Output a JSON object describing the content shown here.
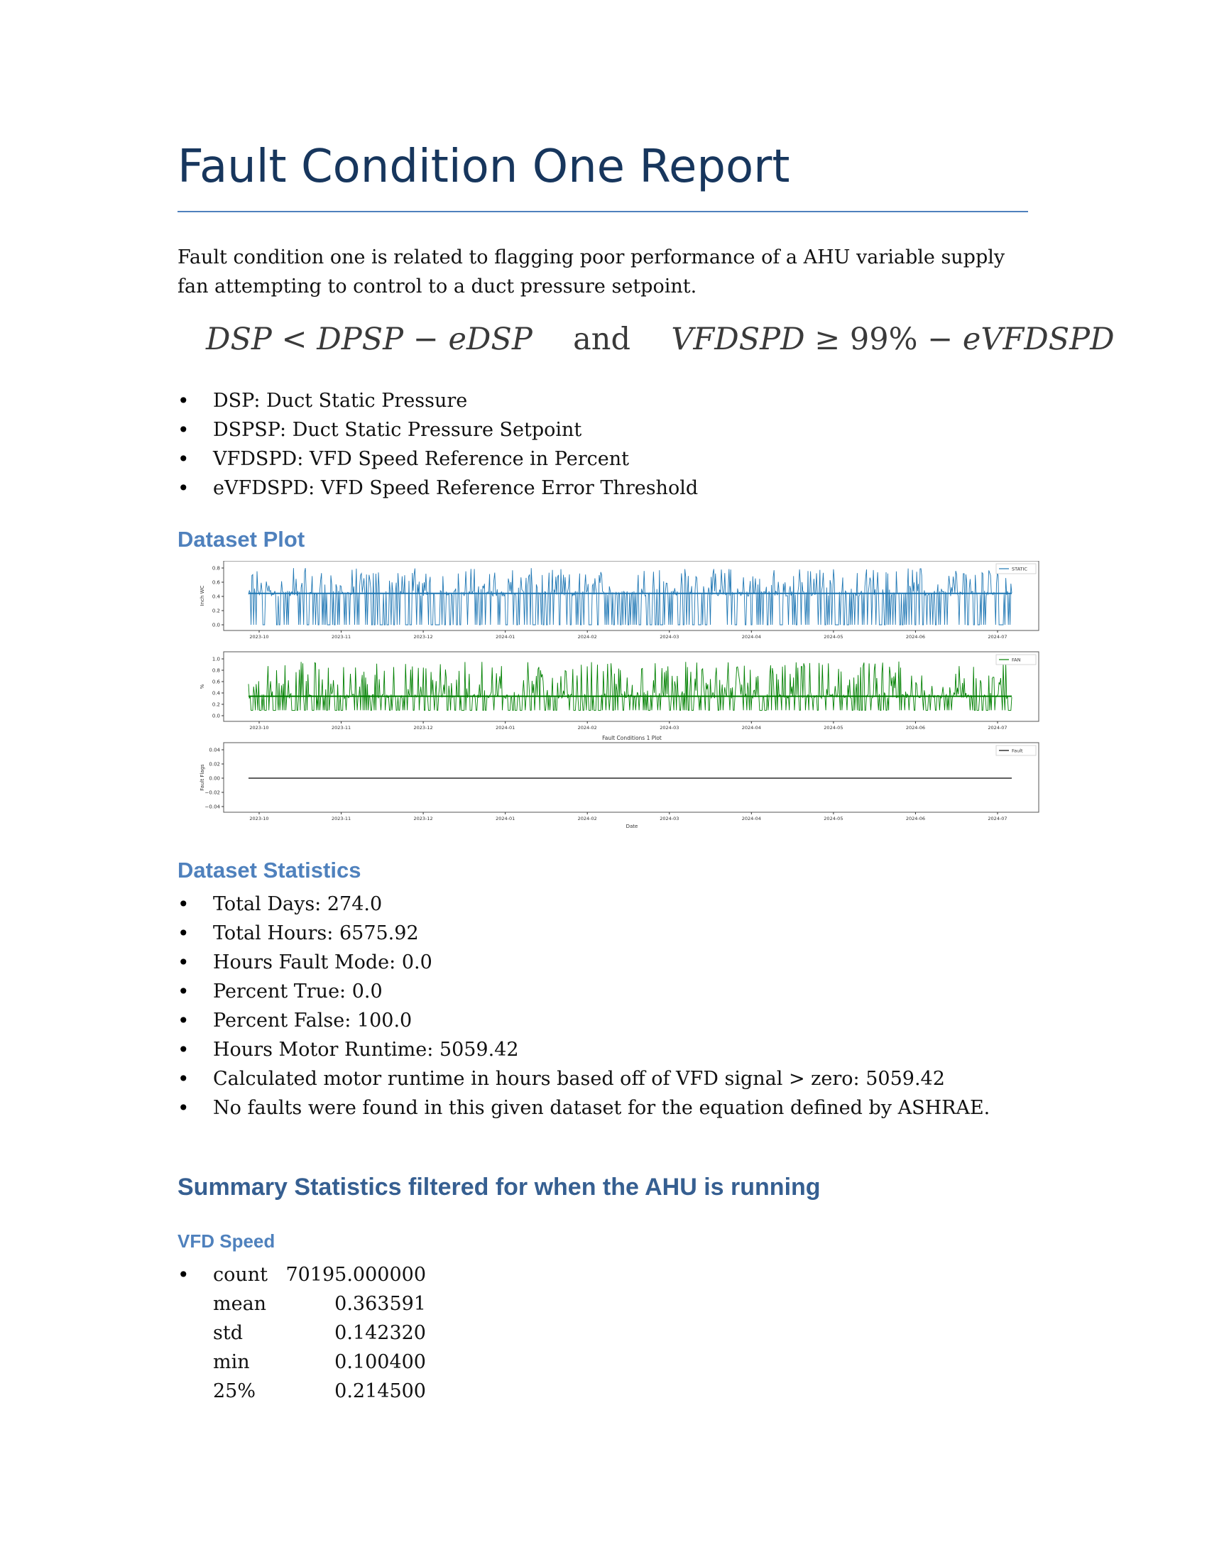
{
  "title": "Fault Condition One Report",
  "intro": "Fault condition one is related to flagging poor performance of a AHU variable supply fan attempting to control to a duct pressure setpoint.",
  "equation": {
    "lhs_a": "DSP",
    "lt": "<",
    "lhs_b": "DPSP",
    "minus1": "−",
    "lhs_c": "eDSP",
    "and": "and",
    "rhs_a": "VFDSPD",
    "ge": "≥",
    "rhs_b": "99%",
    "minus2": "−",
    "rhs_c": "eVFDSPD"
  },
  "definitions": [
    "DSP: Duct Static Pressure",
    "DSPSP: Duct Static Pressure Setpoint",
    "VFDSPD: VFD Speed Reference in Percent",
    "eVFDSPD: VFD Speed Reference Error Threshold"
  ],
  "dataset_plot_heading": "Dataset Plot",
  "chart_data": [
    {
      "type": "line",
      "x_ticks": [
        "2023-10",
        "2023-11",
        "2023-12",
        "2024-01",
        "2024-02",
        "2024-03",
        "2024-04",
        "2024-05",
        "2024-06",
        "2024-07"
      ],
      "ylabel": "Inch WC",
      "y_ticks": [
        "0.8",
        "0.6",
        "0.4",
        "0.2",
        "0.0"
      ],
      "ylim": [
        0.0,
        0.85
      ],
      "series": [
        {
          "name": "STATIC",
          "color": "#1f77b4",
          "baseline": 0.47,
          "low": 0.0,
          "high": 0.85
        }
      ]
    },
    {
      "type": "line",
      "x_ticks": [
        "2023-10",
        "2023-11",
        "2023-12",
        "2024-01",
        "2024-02",
        "2024-03",
        "2024-04",
        "2024-05",
        "2024-06",
        "2024-07"
      ],
      "ylabel": "%",
      "y_ticks": [
        "1.0",
        "0.8",
        "0.6",
        "0.4",
        "0.2",
        "0.0"
      ],
      "ylim": [
        0.0,
        1.05
      ],
      "series": [
        {
          "name": "FAN",
          "color": "#008000",
          "baseline": 0.36,
          "low": 0.1,
          "high": 1.0
        }
      ]
    },
    {
      "type": "line",
      "title": "Fault Conditions 1 Plot",
      "x_ticks": [
        "2023-10",
        "2023-11",
        "2023-12",
        "2024-01",
        "2024-02",
        "2024-03",
        "2024-04",
        "2024-05",
        "2024-06",
        "2024-07"
      ],
      "xlabel": "Date",
      "ylabel": "Fault Flags",
      "y_ticks": [
        "0.04",
        "0.02",
        "0.00",
        "−0.02",
        "−0.04"
      ],
      "ylim": [
        -0.05,
        0.05
      ],
      "series": [
        {
          "name": "Fault",
          "color": "#000000",
          "value": 0.0
        }
      ]
    }
  ],
  "dataset_statistics_heading": "Dataset Statistics",
  "statistics": [
    "Total Days: 274.0",
    "Total Hours: 6575.92",
    "Hours Fault Mode: 0.0",
    "Percent True: 0.0",
    "Percent False: 100.0",
    "Hours Motor Runtime: 5059.42",
    "Calculated motor runtime in hours based off of VFD signal > zero: 5059.42",
    "No faults were found in this given dataset for the equation defined by ASHRAE."
  ],
  "summary_heading": "Summary Statistics filtered for when the AHU is running",
  "vfd_heading": "VFD Speed",
  "vfd_stats": [
    {
      "k": "count",
      "v": "70195.000000"
    },
    {
      "k": "mean",
      "v": "0.363591"
    },
    {
      "k": "std",
      "v": "0.142320"
    },
    {
      "k": "min",
      "v": "0.100400"
    },
    {
      "k": "25%",
      "v": "0.214500"
    }
  ]
}
